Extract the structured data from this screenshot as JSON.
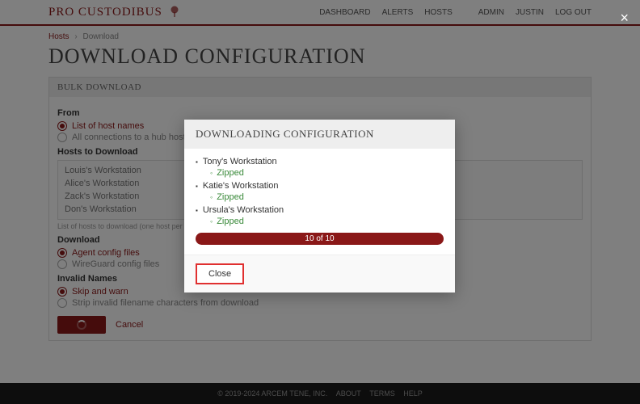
{
  "brand": "PRO CUSTODIBUS",
  "nav": {
    "dashboard": "DASHBOARD",
    "alerts": "ALERTS",
    "hosts": "HOSTS",
    "admin": "ADMIN",
    "user": "JUSTIN",
    "logout": "LOG OUT"
  },
  "breadcrumb": {
    "root": "Hosts",
    "current": "Download"
  },
  "title": "DOWNLOAD CONFIGURATION",
  "panel": {
    "header": "BULK DOWNLOAD",
    "from_label": "From",
    "from_opt1": "List of host names",
    "from_opt2": "All connections to a hub host",
    "hosts_label": "Hosts to Download",
    "hosts": [
      "Louis's Workstation",
      "Alice's Workstation",
      "Zack's Workstation",
      "Don's Workstation"
    ],
    "hosts_hint": "List of hosts to download (one host per line)",
    "download_label": "Download",
    "dl_opt1": "Agent config files",
    "dl_opt2": "WireGuard config files",
    "invalid_label": "Invalid Names",
    "inv_opt1": "Skip and warn",
    "inv_opt2": "Strip invalid filename characters from download",
    "cancel": "Cancel"
  },
  "modal": {
    "title": "DOWNLOADING CONFIGURATION",
    "items": [
      {
        "name": "Tony's Workstation",
        "status": "Zipped"
      },
      {
        "name": "Katie's Workstation",
        "status": "Zipped"
      },
      {
        "name": "Ursula's Workstation",
        "status": "Zipped"
      }
    ],
    "progress": "10 of 10",
    "close": "Close"
  },
  "footer": {
    "copy": "© 2019-2024 ARCEM TENE, INC.",
    "about": "ABOUT",
    "terms": "TERMS",
    "help": "HELP"
  }
}
